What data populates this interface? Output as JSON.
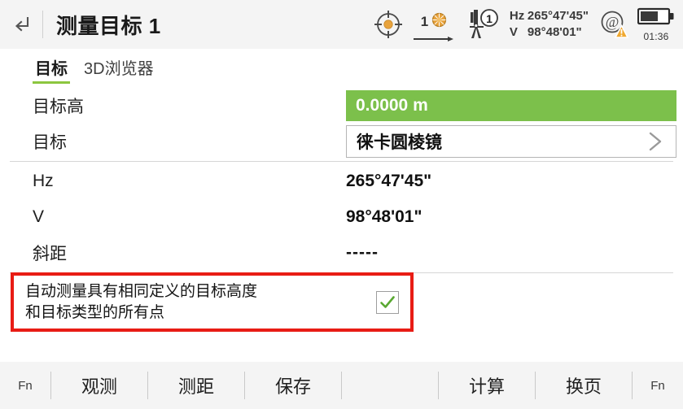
{
  "header": {
    "back_icon": "back-arrow-icon",
    "title": "测量目标 1",
    "icons": {
      "crosshair": "crosshair-target-icon",
      "prism_count": "1",
      "prism_icon": "prism-icon",
      "prism_arrow": "arrow-right-icon",
      "station_icon": "total-station-icon",
      "station_badge": "1",
      "atr_icon": "atr-warning-icon",
      "battery_icon": "battery-icon"
    },
    "angles": {
      "hz_key": "Hz",
      "hz_value": "265°47'45\"",
      "v_key": "V",
      "v_value": "98°48'01\""
    },
    "battery_time": "01:36",
    "battery_percent": 60
  },
  "tabs": [
    {
      "label": "目标",
      "active": true
    },
    {
      "label": "3D浏览器",
      "active": false
    }
  ],
  "form": {
    "rows": [
      {
        "label": "目标高",
        "value": "0.0000 m",
        "type": "green"
      },
      {
        "label": "目标",
        "value": "徕卡圆棱镜",
        "type": "select"
      },
      {
        "label": "Hz",
        "value": "265°47'45\"",
        "type": "text"
      },
      {
        "label": "V",
        "value": "98°48'01\"",
        "type": "text"
      },
      {
        "label": "斜距",
        "value": "-----",
        "type": "text"
      }
    ]
  },
  "highlight": {
    "text_line1": "自动测量具有相同定义的目标高度",
    "text_line2": "和目标类型的所有点",
    "checked": true,
    "check_icon": "checkmark-icon",
    "border_color": "#e81c15"
  },
  "toolbar": {
    "fn_left": "Fn",
    "buttons": [
      "观测",
      "测距",
      "保存"
    ],
    "buttons_right": [
      "计算",
      "换页"
    ],
    "fn_right": "Fn"
  },
  "colors": {
    "accent_green": "#7cc04b",
    "tab_underline": "#8cc63f",
    "highlight_red": "#e81c15",
    "header_bg": "#f4f4f4",
    "orange": "#e8a33d"
  }
}
